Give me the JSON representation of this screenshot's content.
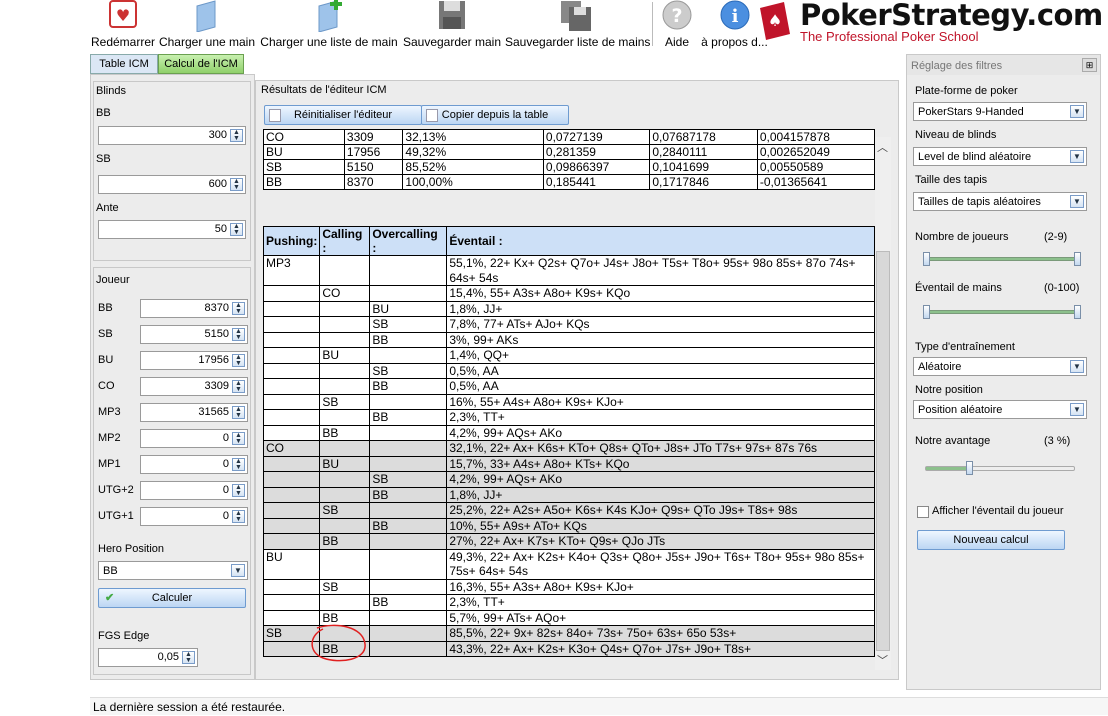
{
  "toolbar": {
    "restart": "Redémarrer",
    "load_hand": "Charger une main",
    "load_hand_list": "Charger une liste de main",
    "save_hand": "Sauvegarder main",
    "save_hand_list": "Sauvegarder liste de mains",
    "help": "Aide",
    "about": "à propos d..."
  },
  "logo": {
    "title": "PokerStrategy.com",
    "subtitle": "The Professional Poker School"
  },
  "tabs": [
    "Table ICM",
    "Calcul de l'ICM"
  ],
  "left": {
    "blinds_title": "Blinds",
    "bb_label": "BB",
    "bb_value": "300",
    "sb_label": "SB",
    "sb_value": "600",
    "ante_label": "Ante",
    "ante_value": "50",
    "player_title": "Joueur",
    "players": [
      {
        "label": "BB",
        "value": "8370"
      },
      {
        "label": "SB",
        "value": "5150"
      },
      {
        "label": "BU",
        "value": "17956"
      },
      {
        "label": "CO",
        "value": "3309"
      },
      {
        "label": "MP3",
        "value": "31565"
      },
      {
        "label": "MP2",
        "value": "0"
      },
      {
        "label": "MP1",
        "value": "0"
      },
      {
        "label": "UTG+2",
        "value": "0"
      },
      {
        "label": "UTG+1",
        "value": "0"
      }
    ],
    "hero_label": "Hero Position",
    "hero_value": "BB",
    "calc_button": "Calculer",
    "fgs_label": "FGS Edge",
    "fgs_value": "0,05"
  },
  "center": {
    "title": "Résultats de l'éditeur ICM",
    "reset_button": "Réinitialiser l'éditeur",
    "copy_button": "Copier depuis la table",
    "stacks": [
      [
        "CO",
        "3309",
        "32,13%",
        "0,0727139",
        "0,07687178",
        "0,004157878"
      ],
      [
        "BU",
        "17956",
        "49,32%",
        "0,281359",
        "0,2840111",
        "0,002652049"
      ],
      [
        "SB",
        "5150",
        "85,52%",
        "0,09866397",
        "0,1041699",
        "0,00550589"
      ],
      [
        "BB",
        "8370",
        "100,00%",
        "0,185441",
        "0,1717846",
        "-0,01365641"
      ]
    ],
    "headers": [
      "Pushing:",
      "Calling :",
      "Overcalling :",
      "Éventail :"
    ],
    "ranges": [
      [
        "MP3",
        "",
        "",
        "55,1%, 22+ Kx+ Q2s+ Q7o+ J4s+ J8o+ T5s+ T8o+ 95s+ 98o 85s+ 87o 74s+ 64s+ 54s"
      ],
      [
        "",
        "CO",
        "",
        "15,4%, 55+ A3s+ A8o+ K9s+ KQo"
      ],
      [
        "",
        "",
        "BU",
        "1,8%, JJ+"
      ],
      [
        "",
        "",
        "SB",
        "7,8%, 77+ ATs+ AJo+ KQs"
      ],
      [
        "",
        "",
        "BB",
        "3%, 99+ AKs"
      ],
      [
        "",
        "BU",
        "",
        "1,4%, QQ+"
      ],
      [
        "",
        "",
        "SB",
        "0,5%, AA"
      ],
      [
        "",
        "",
        "BB",
        "0,5%, AA"
      ],
      [
        "",
        "SB",
        "",
        "16%, 55+ A4s+ A8o+ K9s+ KJo+"
      ],
      [
        "",
        "",
        "BB",
        "2,3%, TT+"
      ],
      [
        "",
        "BB",
        "",
        "4,2%, 99+ AQs+ AKo"
      ],
      [
        "CO",
        "",
        "",
        "32,1%, 22+ Ax+ K6s+ KTo+ Q8s+ QTo+ J8s+ JTo T7s+ 97s+ 87s 76s"
      ],
      [
        "",
        "BU",
        "",
        "15,7%, 33+ A4s+ A8o+ KTs+ KQo"
      ],
      [
        "",
        "",
        "SB",
        "4,2%, 99+ AQs+ AKo"
      ],
      [
        "",
        "",
        "BB",
        "1,8%, JJ+"
      ],
      [
        "",
        "SB",
        "",
        "25,2%, 22+ A2s+ A5o+ K6s+ K4s KJo+ Q9s+ QTo J9s+ T8s+ 98s"
      ],
      [
        "",
        "",
        "BB",
        "10%, 55+ A9s+ ATo+ KQs"
      ],
      [
        "",
        "BB",
        "",
        "27%, 22+ Ax+ K7s+ KTo+ Q9s+ QJo JTs"
      ],
      [
        "BU",
        "",
        "",
        "49,3%, 22+ Ax+ K2s+ K4o+ Q3s+ Q8o+ J5s+ J9o+ T6s+ T8o+ 95s+ 98o 85s+ 75s+ 64s+ 54s"
      ],
      [
        "",
        "SB",
        "",
        "16,3%, 55+ A3s+ A8o+ K9s+ KJo+"
      ],
      [
        "",
        "",
        "BB",
        "2,3%, TT+"
      ],
      [
        "",
        "BB",
        "",
        "5,7%, 99+ ATs+ AQo+"
      ],
      [
        "SB",
        "",
        "",
        "85,5%, 22+ 9x+ 82s+ 84o+ 73s+ 75o+ 63s+ 65o 53s+"
      ],
      [
        "",
        "BB",
        "",
        "43,3%, 22+ Ax+ K2s+ K3o+ Q4s+ Q7o+ J7s+ J9o+ T8s+"
      ]
    ]
  },
  "right": {
    "panel_title": "Réglage des filtres",
    "platform_label": "Plate-forme de poker",
    "platform_value": "PokerStars 9-Handed",
    "blind_level_label": "Niveau de blinds",
    "blind_level_value": "Level de blind aléatoire",
    "stack_size_label": "Taille des tapis",
    "stack_size_value": "Tailles de tapis aléatoires",
    "players_label": "Nombre de joueurs",
    "players_range": "(2-9)",
    "hand_range_label": "Éventail de mains",
    "hand_range_range": "(0-100)",
    "training_label": "Type d'entraînement",
    "training_value": "Aléatoire",
    "position_label": "Notre position",
    "position_value": "Position aléatoire",
    "edge_label": "Notre avantage",
    "edge_value": "(3 %)",
    "edge_fraction": 0.3,
    "show_range_label": "Afficher l'éventail du joueur",
    "new_calc_button": "Nouveau calcul"
  },
  "status": "La dernière session a été restaurée."
}
